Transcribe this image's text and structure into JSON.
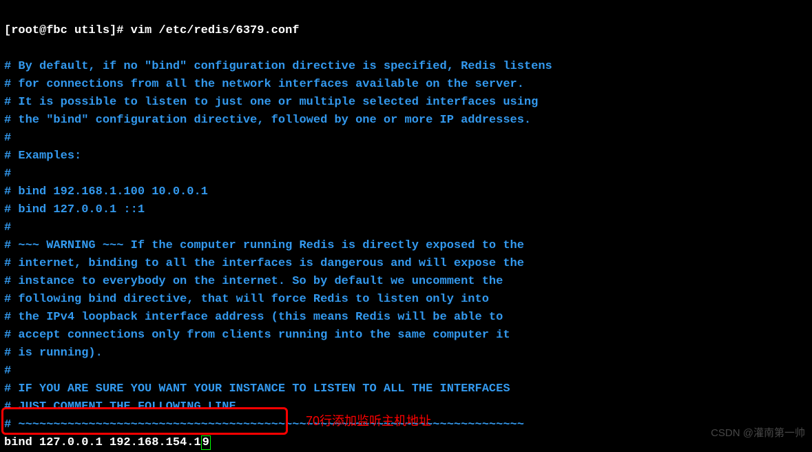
{
  "prompt": "[root@fbc utils]# vim /etc/redis/6379.conf",
  "lines": [
    "",
    "# By default, if no \"bind\" configuration directive is specified, Redis listens",
    "# for connections from all the network interfaces available on the server.",
    "# It is possible to listen to just one or multiple selected interfaces using",
    "# the \"bind\" configuration directive, followed by one or more IP addresses.",
    "#",
    "# Examples:",
    "#",
    "# bind 192.168.1.100 10.0.0.1",
    "# bind 127.0.0.1 ::1",
    "#",
    "# ~~~ WARNING ~~~ If the computer running Redis is directly exposed to the",
    "# internet, binding to all the interfaces is dangerous and will expose the",
    "# instance to everybody on the internet. So by default we uncomment the",
    "# following bind directive, that will force Redis to listen only into",
    "# the IPv4 loopback interface address (this means Redis will be able to",
    "# accept connections only from clients running into the same computer it",
    "# is running).",
    "#",
    "# IF YOU ARE SURE YOU WANT YOUR INSTANCE TO LISTEN TO ALL THE INTERFACES",
    "# JUST COMMENT THE FOLLOWING LINE.",
    "# ~~~~~~~~~~~~~~~~~~~~~~~~~~~~~~~~~~~~~~~~~~~~~~~~~~~~~~~~~~~~~~~~~~~~~~~~"
  ],
  "bind_line_prefix": "bind 127.0.0.1 192.168.154.1",
  "bind_line_cursor": "9",
  "annotation": "70行添加监听主机地址",
  "watermark": "CSDN @灌南第一帅"
}
